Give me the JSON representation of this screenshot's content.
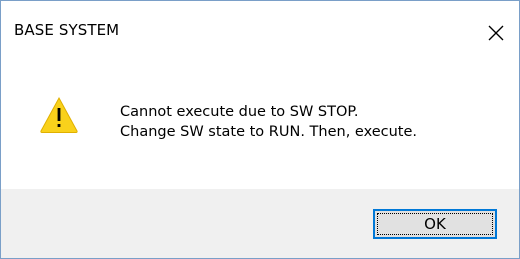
{
  "window": {
    "title": "BASE SYSTEM",
    "close_icon": "close-icon"
  },
  "dialog": {
    "icon": "warning-icon",
    "message_line1": "Cannot execute due to SW STOP.",
    "message_line2": "Change SW state to RUN. Then, execute."
  },
  "buttons": {
    "ok_label": "OK"
  },
  "colors": {
    "accent": "#0078d7",
    "warning_fill": "#f9d11b",
    "footer_bg": "#f0f0f0"
  }
}
